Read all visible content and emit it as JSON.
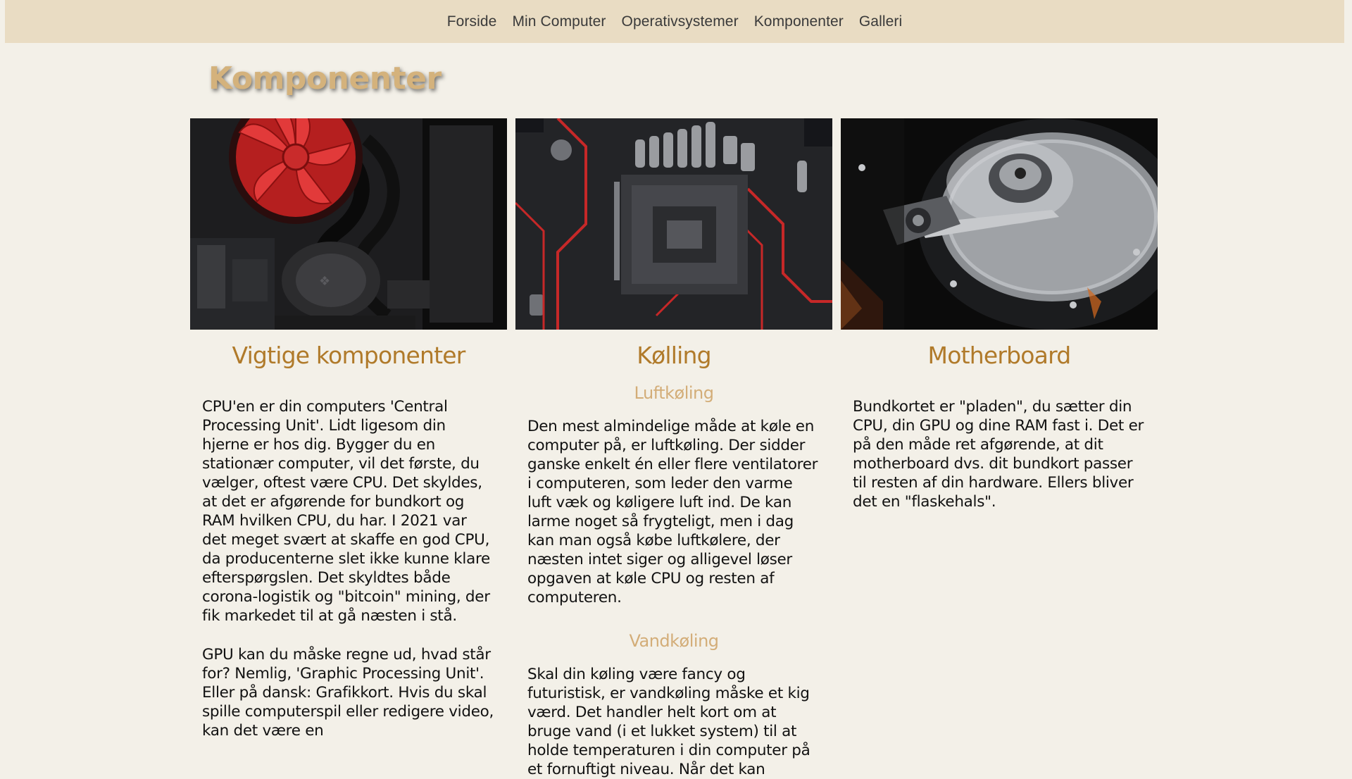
{
  "nav": {
    "items": [
      {
        "label": "Forside"
      },
      {
        "label": "Min Computer"
      },
      {
        "label": "Operativsystemer"
      },
      {
        "label": "Komponenter"
      },
      {
        "label": "Galleri"
      }
    ]
  },
  "page": {
    "title": "Komponenter"
  },
  "columns": [
    {
      "heading": "Vigtige komponenter",
      "image_icon": "cpu-cooler-image",
      "paragraphs": [
        "CPU'en er din computers 'Central Processing Unit'. Lidt ligesom din hjerne er hos dig. Bygger du en stationær computer, vil det første, du vælger, oftest være CPU. Det skyldes, at det er afgørende for bundkort og RAM hvilken CPU, du har. I 2021 var det meget svært at skaffe en god CPU, da producenterne slet ikke kunne klare efterspørgslen. Det skyldtes både corona-logistik og \"bitcoin\" mining, der fik markedet til at gå næsten i stå.",
        "GPU kan du måske regne ud, hvad står for? Nemlig, 'Graphic Processing Unit'. Eller på dansk: Grafikkort. Hvis du skal spille computerspil eller redigere video, kan det være en"
      ]
    },
    {
      "heading": "Kølling",
      "image_icon": "motherboard-socket-image",
      "sub1": "Luftkøling",
      "para1": "Den mest almindelige måde at køle en computer på, er luftkøling. Der sidder ganske enkelt én eller flere ventilatorer i computeren, som leder den varme luft væk og køligere luft ind. De kan larme noget så frygteligt, men i dag kan man også købe luftkølere, der næsten intet siger og alligevel løser opgaven at køle CPU og resten af computeren.",
      "sub2": "Vandkøling",
      "para2": "Skal din køling være fancy og futuristisk, er vandkøling måske et kig værd. Det handler helt kort om at bruge vand (i et lukket system) til at holde temperaturen i din computer på et fornuftigt niveau. Når det kan"
    },
    {
      "heading": "Motherboard",
      "image_icon": "hard-drive-image",
      "paragraphs": [
        "Bundkortet er \"pladen\", du sætter din CPU, din GPU og dine RAM fast i. Det er på den måde ret afgørende, at dit motherboard dvs. dit bundkort passer til resten af din hardware. Ellers bliver det en \"flaskehals\"."
      ]
    }
  ]
}
